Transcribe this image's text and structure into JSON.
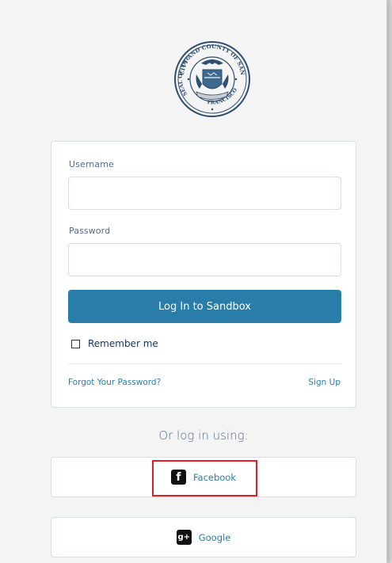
{
  "seal": {
    "top_text": "CITY AND COUNTY OF SAN",
    "bottom_text": "SEAL OF THE",
    "lower_text": "FRANCISCO"
  },
  "login_form": {
    "username_label": "Username",
    "username_value": "",
    "password_label": "Password",
    "password_value": "",
    "login_button_label": "Log In to Sandbox",
    "remember_me_label": "Remember me",
    "remember_me_checked": false,
    "forgot_password_link": "Forgot Your Password?",
    "sign_up_link": "Sign Up"
  },
  "social_login": {
    "heading": "Or log in using:",
    "providers": [
      {
        "label": "Facebook",
        "icon": "facebook-icon",
        "icon_glyph": "f"
      },
      {
        "label": "Google",
        "icon": "google-plus-icon",
        "icon_glyph": "g+"
      }
    ]
  },
  "colors": {
    "primary_button": "#2a7da8",
    "link": "#2a7da8",
    "highlight_box": "#e01e26",
    "background": "#f4f4f4"
  }
}
